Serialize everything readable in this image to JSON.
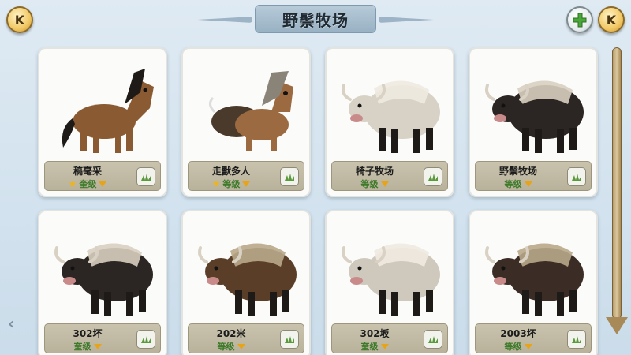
{
  "header": {
    "back_label": "K",
    "close_label": "K",
    "title": "野鬃牧场"
  },
  "cards": [
    {
      "name": "稿毫采",
      "level": "奎级",
      "has_star": true,
      "animal": "horse",
      "color": "#8a5a32"
    },
    {
      "name": "走獸多人",
      "level": "等级",
      "has_star": true,
      "animal": "horse-yak",
      "color": "#9b6a40"
    },
    {
      "name": "犄子牧场",
      "level": "等级",
      "has_star": false,
      "animal": "yak-white",
      "color": "#d8d2c6"
    },
    {
      "name": "野鬃牧场",
      "level": "等级",
      "has_star": false,
      "animal": "yak-black",
      "color": "#2b2623"
    },
    {
      "name": "302坏",
      "level": "奎级",
      "has_star": false,
      "animal": "yak-black",
      "color": "#2b2623"
    },
    {
      "name": "202米",
      "level": "等级",
      "has_star": false,
      "animal": "yak-brown",
      "color": "#5a3e28"
    },
    {
      "name": "302坂",
      "level": "奎级",
      "has_star": false,
      "animal": "yak-white",
      "color": "#cfc8bc"
    },
    {
      "name": "2003坏",
      "level": "等级",
      "has_star": false,
      "animal": "yak-dark",
      "color": "#3b2d25"
    }
  ],
  "icons": {
    "back": "back-icon",
    "close": "close-icon",
    "add": "add-icon",
    "scroll_down": "arrow-down-icon",
    "scroll_left": "chevron-left-icon"
  },
  "colors": {
    "accent_gold": "#f1c865",
    "level_green": "#3d7a2a",
    "plate": "#c9c3ae"
  }
}
